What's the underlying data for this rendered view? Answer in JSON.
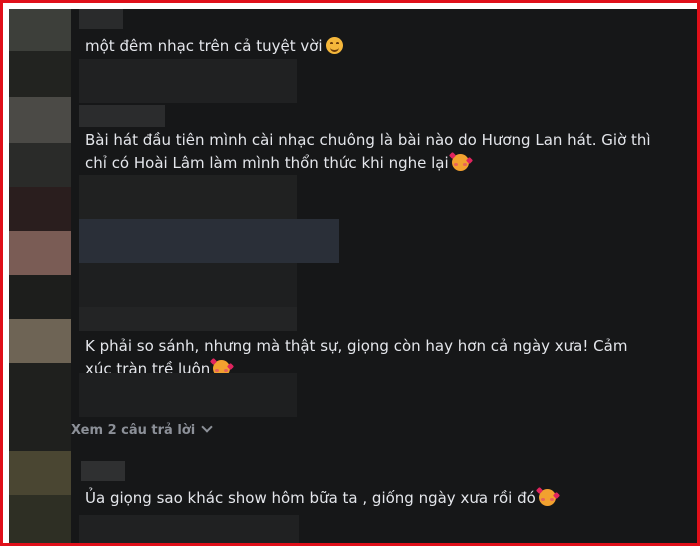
{
  "comments": [
    {
      "text": "một đêm nhạc trên cả tuyệt vời",
      "emoji": "smiling-face-icon"
    },
    {
      "text": "Bài hát đầu tiên mình cài nhạc chuông là bài nào do Hương Lan hát. Giờ thì chỉ có Hoài Lâm làm mình thổn thức khi nghe lại",
      "emoji": "smiling-face-with-hearts-icon"
    },
    {
      "text": "K phải so sánh, nhưng mà thật sự, giọng còn hay hơn cả ngày xưa! Cảm xúc tràn trề luôn",
      "emoji": "smiling-face-with-hearts-icon"
    },
    {
      "text": "Ủa giọng sao khác show hôm bữa ta , giống ngày xưa rồi đó",
      "emoji": "smiling-face-with-hearts-icon"
    }
  ],
  "view_replies": {
    "label": "Xem 2 câu trả lời",
    "icon": "chevron-down-icon"
  },
  "colors": {
    "background": "#161718",
    "text": "#e4e6eb",
    "muted": "#8c9098",
    "frame_border": "#e0101a"
  }
}
